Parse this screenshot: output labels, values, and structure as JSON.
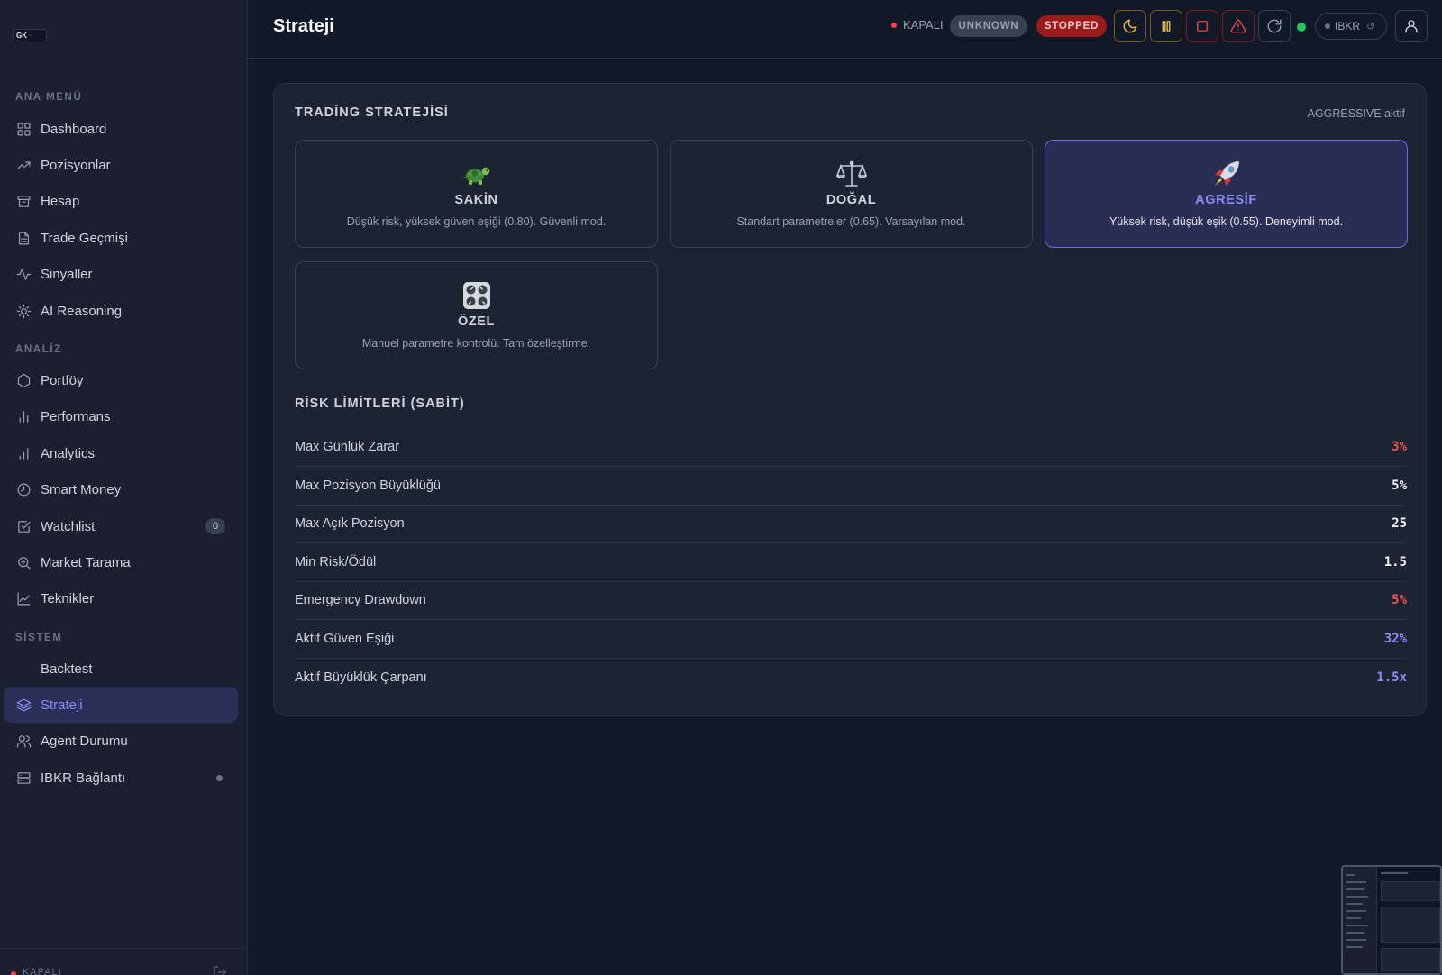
{
  "app": {
    "logo_text": "GK",
    "page_title": "Strateji"
  },
  "sidebar": {
    "sections": [
      {
        "label": "ANA MENÜ",
        "items": [
          {
            "label": "Dashboard",
            "icon": "grid-icon"
          },
          {
            "label": "Pozisyonlar",
            "icon": "trending-up-icon"
          },
          {
            "label": "Hesap",
            "icon": "archive-icon"
          },
          {
            "label": "Trade Geçmişi",
            "icon": "file-text-icon"
          },
          {
            "label": "Sinyaller",
            "icon": "activity-icon"
          },
          {
            "label": "AI Reasoning",
            "icon": "sun-icon"
          }
        ]
      },
      {
        "label": "ANALİZ",
        "items": [
          {
            "label": "Portföy",
            "icon": "hexagon-icon"
          },
          {
            "label": "Performans",
            "icon": "bar-chart-icon"
          },
          {
            "label": "Analytics",
            "icon": "bar-chart-2-icon"
          },
          {
            "label": "Smart Money",
            "icon": "clock-icon"
          },
          {
            "label": "Watchlist",
            "icon": "check-square-icon",
            "badge": "0"
          },
          {
            "label": "Market Tarama",
            "icon": "zoom-in-icon"
          },
          {
            "label": "Teknikler",
            "icon": "line-chart-icon"
          }
        ]
      },
      {
        "label": "SİSTEM",
        "items": [
          {
            "label": "Backtest",
            "icon": ""
          },
          {
            "label": "Strateji",
            "icon": "layers-icon",
            "active": true
          },
          {
            "label": "Agent Durumu",
            "icon": "users-icon"
          },
          {
            "label": "IBKR Bağlantı",
            "icon": "server-icon"
          }
        ]
      }
    ],
    "footer_status": "KAPALI"
  },
  "header": {
    "connection_status": "KAPALI",
    "pill_unknown": "UNKNOWN",
    "pill_stopped": "STOPPED",
    "broker_label": "IBKR",
    "broker_refresh_glyph": "↺",
    "status_colors": {
      "offline": "#ef4444",
      "online": "#22c55e",
      "stopped": "#991b1b"
    }
  },
  "strategy": {
    "title": "TRADİNG STRATEJİSİ",
    "active_note": "AGGRESSIVE aktif",
    "options": [
      {
        "name": "SAKİN",
        "desc": "Düşük risk, yüksek güven eşiği (0.80). Güvenli mod.",
        "icon": "turtle-icon",
        "selected": false
      },
      {
        "name": "DOĞAL",
        "desc": "Standart parametreler (0.65). Varsayılan mod.",
        "icon": "balance-scale-icon",
        "selected": false
      },
      {
        "name": "AGRESİF",
        "desc": "Yüksek risk, düşük eşik (0.55). Deneyimli mod.",
        "icon": "rocket-icon",
        "selected": true
      },
      {
        "name": "ÖZEL",
        "desc": "Manuel parametre kontrolü. Tam özelleştirme.",
        "icon": "control-knobs-icon",
        "selected": false
      }
    ]
  },
  "risk": {
    "title": "RİSK LİMİTLERİ (SABİT)",
    "rows": [
      {
        "label": "Max Günlük Zarar",
        "value": "3%",
        "tone": "red"
      },
      {
        "label": "Max Pozisyon Büyüklüğü",
        "value": "5%",
        "tone": "white"
      },
      {
        "label": "Max Açık Pozisyon",
        "value": "25",
        "tone": "white"
      },
      {
        "label": "Min Risk/Ödül",
        "value": "1.5",
        "tone": "white"
      },
      {
        "label": "Emergency Drawdown",
        "value": "5%",
        "tone": "red"
      },
      {
        "label": "Aktif Güven Eşiği",
        "value": "32%",
        "tone": "purple"
      },
      {
        "label": "Aktif Büyüklük Çarpanı",
        "value": "1.5x",
        "tone": "purple"
      }
    ]
  },
  "colors": {
    "accent": "#8b8cf6",
    "danger": "#ef5350",
    "background": "#111827",
    "sidebar": "#1a2030"
  }
}
